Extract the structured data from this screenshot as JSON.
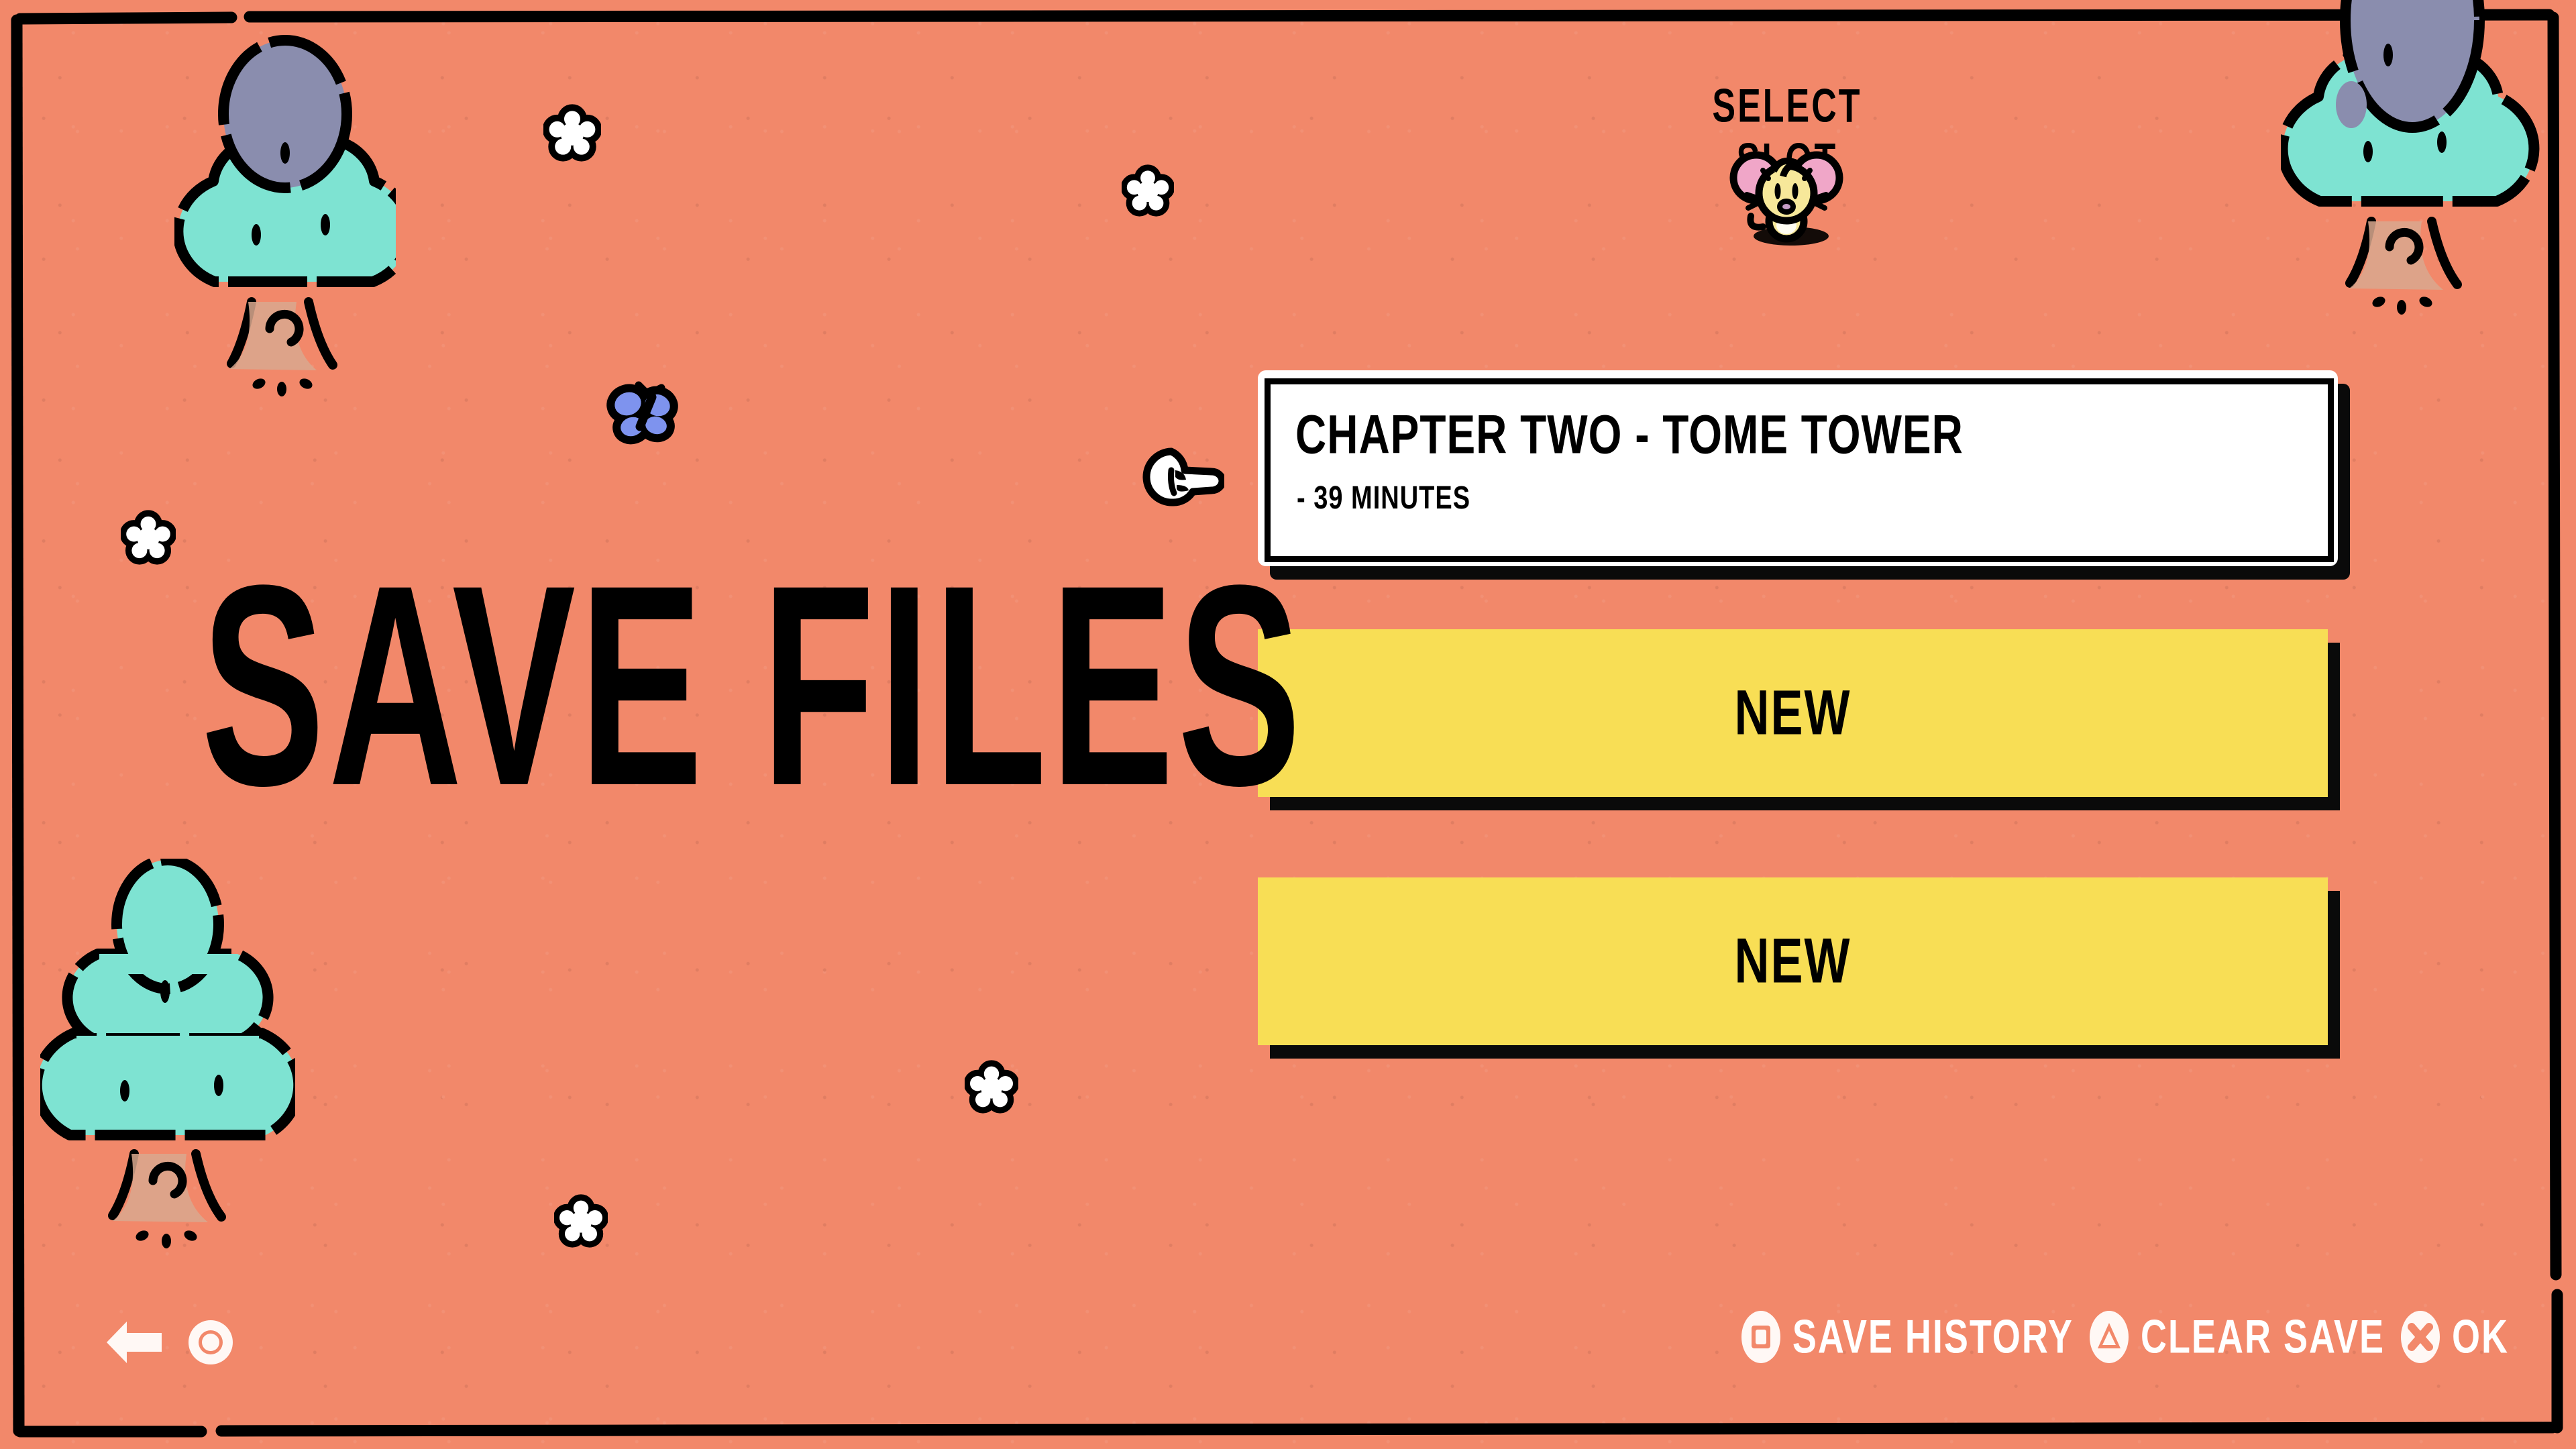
{
  "screen": {
    "name": "save-files",
    "title": "SAVE FILES",
    "background_color": "#F2886A",
    "frame_color": "#000000"
  },
  "header": {
    "label": "SELECT SLOT",
    "mascot": "mouse-mascot",
    "mascot_colors": {
      "body": "#F7E89A",
      "ears": "#F0A6C8",
      "outline": "#000000",
      "nose": "#C79CC6"
    }
  },
  "cursor": {
    "icon": "pointing-hand-cursor",
    "points_at": "slot-1"
  },
  "slots": [
    {
      "index": 1,
      "type": "saved",
      "title": "CHAPTER TWO - TOME TOWER",
      "subtitle": "- 39 MINUTES",
      "selected": true,
      "bg_color": "#FFFFFF"
    },
    {
      "index": 2,
      "type": "new",
      "label": "NEW",
      "bg_color": "#F8DE55"
    },
    {
      "index": 3,
      "type": "new",
      "label": "NEW",
      "bg_color": "#F8DE55"
    }
  ],
  "nav_left": [
    {
      "icon": "back-arrow-icon",
      "color": "#FFFFFF"
    },
    {
      "icon": "circle-button-icon",
      "color": "#FFFFFF"
    }
  ],
  "hints": [
    {
      "icon": "square-button-icon",
      "label": "SAVE HISTORY"
    },
    {
      "icon": "triangle-button-icon",
      "label": "CLEAR SAVE"
    },
    {
      "icon": "cross-button-icon",
      "label": "OK"
    }
  ],
  "decorations": {
    "trees": [
      {
        "id": "tree-top-left",
        "top_color": "#8A8DAE",
        "leaf_color": "#7EE3D2",
        "trunk_color": "#D9A88E"
      },
      {
        "id": "tree-top-right",
        "top_color": "#8A8DAE",
        "leaf_color": "#7EE3D2",
        "trunk_color": "#D9A88E"
      },
      {
        "id": "tree-bottom-left",
        "top_color": "#7EE3D2",
        "leaf_color": "#7EE3D2",
        "trunk_color": "#D9A88E"
      }
    ],
    "flowers": [
      {
        "id": "flower-1",
        "color": "#FFFFFF"
      },
      {
        "id": "flower-2",
        "color": "#FFFFFF"
      },
      {
        "id": "flower-3",
        "color": "#FFFFFF"
      },
      {
        "id": "flower-4",
        "color": "#FFFFFF"
      },
      {
        "id": "flower-5",
        "color": "#FFFFFF"
      },
      {
        "id": "flower-6",
        "color": "#FFFFFF"
      }
    ],
    "butterfly": {
      "id": "butterfly-1",
      "color": "#7E93EE"
    }
  }
}
